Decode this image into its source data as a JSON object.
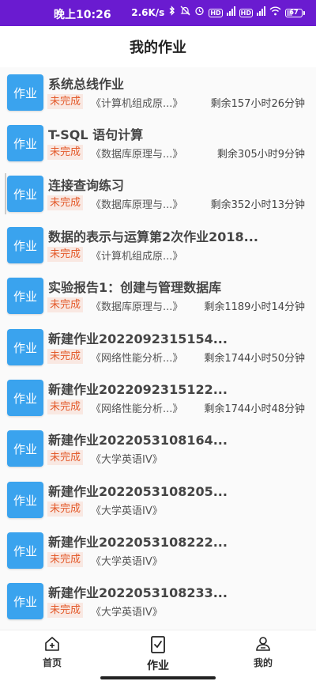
{
  "status_bar": {
    "time": "晚上10:26",
    "speed": "2.6K/s",
    "battery": "67",
    "network_label": "4G",
    "hd_label": "HD"
  },
  "header": {
    "title": "我的作业"
  },
  "badge_text": "作业",
  "assignments": [
    {
      "title": "系统总线作业",
      "status": "未完成",
      "course": "《计算机组成原...》",
      "remaining": "剩余157小时26分钟"
    },
    {
      "title": "T-SQL 语句计算",
      "status": "未完成",
      "course": "《数据库原理与...》",
      "remaining": "剩余305小时9分钟"
    },
    {
      "title": "连接查询练习",
      "status": "未完成",
      "course": "《数据库原理与...》",
      "remaining": "剩余352小时13分钟"
    },
    {
      "title": "数据的表示与运算第2次作业2018...",
      "status": "未完成",
      "course": "《计算机组成原...》",
      "remaining": ""
    },
    {
      "title": "实验报告1：创建与管理数据库",
      "status": "未完成",
      "course": "《数据库原理与...》",
      "remaining": "剩余1189小时14分钟"
    },
    {
      "title": "新建作业2022092315154...",
      "status": "未完成",
      "course": "《网络性能分析...》",
      "remaining": "剩余1744小时50分钟"
    },
    {
      "title": "新建作业2022092315122...",
      "status": "未完成",
      "course": "《网络性能分析...》",
      "remaining": "剩余1744小时48分钟"
    },
    {
      "title": "新建作业2022053108164...",
      "status": "未完成",
      "course": "《大学英语IV》",
      "remaining": ""
    },
    {
      "title": "新建作业2022053108205...",
      "status": "未完成",
      "course": "《大学英语IV》",
      "remaining": ""
    },
    {
      "title": "新建作业2022053108222...",
      "status": "未完成",
      "course": "《大学英语IV》",
      "remaining": ""
    },
    {
      "title": "新建作业2022053108233...",
      "status": "未完成",
      "course": "《大学英语IV》",
      "remaining": ""
    }
  ],
  "bottom_nav": {
    "home": "首页",
    "homework": "作业",
    "mine": "我的"
  },
  "colors": {
    "status_bar": "#6a1bd0",
    "badge": "#3aa3ee",
    "status_text": "#e35a2b",
    "status_bg": "#f9e8e2"
  },
  "icons": {
    "home": "home-icon",
    "homework": "homework-icon",
    "mine": "user-icon"
  }
}
